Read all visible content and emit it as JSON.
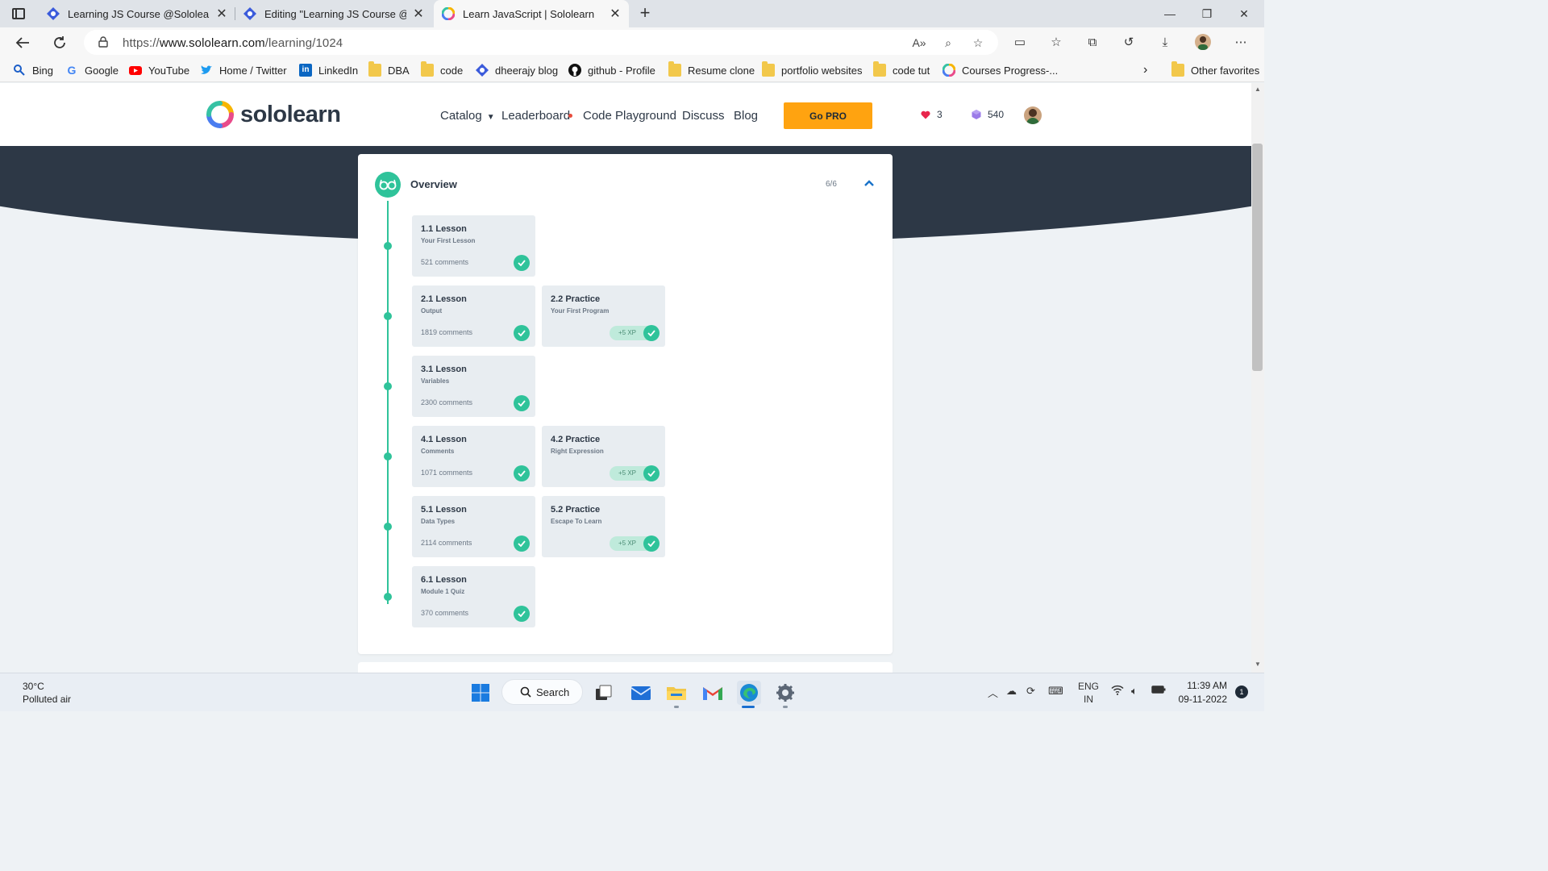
{
  "browser": {
    "tabs": [
      {
        "title": "Learning JS Course @Sololearn -",
        "active": false
      },
      {
        "title": "Editing \"Learning JS Course @So",
        "active": false
      },
      {
        "title": "Learn JavaScript | Sololearn",
        "active": true
      }
    ],
    "new_tab": "+",
    "url_prefix": "https://",
    "url_host": "www.sololearn.com",
    "url_path": "/learning/1024",
    "favorites": [
      {
        "label": "Bing",
        "icon": "search-icon"
      },
      {
        "label": "Google",
        "icon": "google-icon"
      },
      {
        "label": "YouTube",
        "icon": "youtube-icon"
      },
      {
        "label": "Home / Twitter",
        "icon": "twitter-icon"
      },
      {
        "label": "LinkedIn",
        "icon": "linkedin-icon"
      },
      {
        "label": "DBA",
        "icon": "folder-icon"
      },
      {
        "label": "code",
        "icon": "folder-icon"
      },
      {
        "label": "dheerajy blog",
        "icon": "blog-icon"
      },
      {
        "label": "github - Profile",
        "icon": "github-icon"
      },
      {
        "label": "Resume clone",
        "icon": "folder-icon"
      },
      {
        "label": "portfolio websites",
        "icon": "folder-icon"
      },
      {
        "label": "code tut",
        "icon": "folder-icon"
      },
      {
        "label": "Courses Progress-...",
        "icon": "sololearn-icon"
      }
    ],
    "other_favorites": "Other favorites"
  },
  "site": {
    "logo_text": "sololearn",
    "nav": {
      "catalog": "Catalog",
      "leaderboard": "Leaderboard",
      "code_playground": "Code Playground",
      "discuss": "Discuss",
      "blog": "Blog"
    },
    "go_pro": "Go PRO",
    "hearts": "3",
    "gems": "540"
  },
  "overview": {
    "title": "Overview",
    "progress": "6/6",
    "rows": [
      [
        {
          "title": "1.1 Lesson",
          "subtitle": "Your First Lesson",
          "meta": "521 comments",
          "completed": true
        }
      ],
      [
        {
          "title": "2.1 Lesson",
          "subtitle": "Output",
          "meta": "1819 comments",
          "completed": true
        },
        {
          "title": "2.2 Practice",
          "subtitle": "Your First Program",
          "xp": "+5 XP",
          "completed": true
        }
      ],
      [
        {
          "title": "3.1 Lesson",
          "subtitle": "Variables",
          "meta": "2300 comments",
          "completed": true
        }
      ],
      [
        {
          "title": "4.1 Lesson",
          "subtitle": "Comments",
          "meta": "1071 comments",
          "completed": true
        },
        {
          "title": "4.2 Practice",
          "subtitle": "Right Expression",
          "xp": "+5 XP",
          "completed": true
        }
      ],
      [
        {
          "title": "5.1 Lesson",
          "subtitle": "Data Types",
          "meta": "2114 comments",
          "completed": true
        },
        {
          "title": "5.2 Practice",
          "subtitle": "Escape To Learn",
          "xp": "+5 XP",
          "completed": true
        }
      ],
      [
        {
          "title": "6.1 Lesson",
          "subtitle": "Module 1 Quiz",
          "meta": "370 comments",
          "completed": true
        }
      ]
    ]
  },
  "taskbar": {
    "temperature": "30°C",
    "weather": "Polluted air",
    "search": "Search",
    "lang_top": "ENG",
    "lang_bottom": "IN",
    "time": "11:39 AM",
    "date": "09-11-2022",
    "notifications": "1"
  },
  "colors": {
    "accent_green": "#2fc39a",
    "hero_dark": "#2d3846",
    "pro_orange": "#ffa310"
  }
}
